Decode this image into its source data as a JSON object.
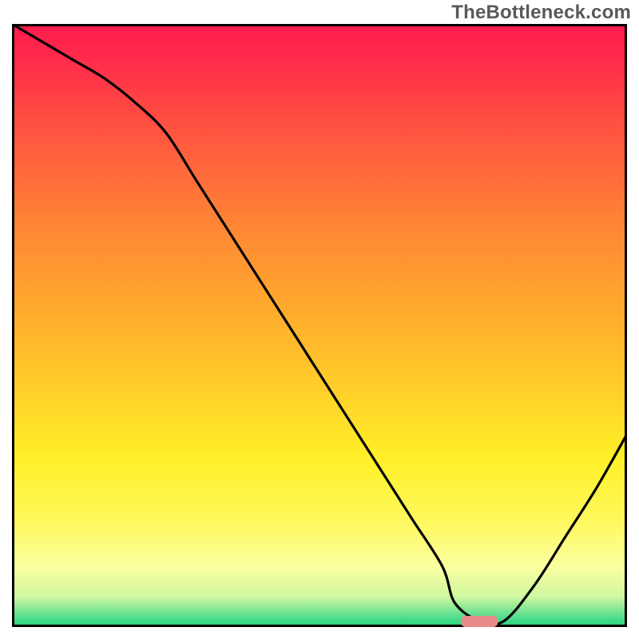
{
  "watermark": "TheBottleneck.com",
  "chart_data": {
    "type": "line",
    "title": "",
    "xlabel": "",
    "ylabel": "",
    "xlim": [
      0,
      100
    ],
    "ylim": [
      0,
      100
    ],
    "x": [
      0,
      5,
      10,
      15,
      20,
      25,
      30,
      35,
      40,
      45,
      50,
      55,
      60,
      65,
      70,
      72,
      76,
      80,
      85,
      90,
      95,
      100
    ],
    "values": [
      100,
      97,
      94,
      91,
      87,
      82,
      74,
      66,
      58,
      50,
      42,
      34,
      26,
      18,
      10,
      4,
      1,
      1,
      7,
      15,
      23,
      32
    ],
    "series": [
      {
        "name": "bottleneck-curve",
        "color": "#000000"
      }
    ],
    "background_gradient": {
      "stops": [
        {
          "offset": 0.0,
          "color": "#ff1a4d"
        },
        {
          "offset": 0.06,
          "color": "#ff2b4a"
        },
        {
          "offset": 0.18,
          "color": "#ff5540"
        },
        {
          "offset": 0.35,
          "color": "#ff8a33"
        },
        {
          "offset": 0.55,
          "color": "#ffbf2a"
        },
        {
          "offset": 0.72,
          "color": "#fff028"
        },
        {
          "offset": 0.82,
          "color": "#fff85a"
        },
        {
          "offset": 0.9,
          "color": "#faffa0"
        },
        {
          "offset": 0.95,
          "color": "#d0f7a0"
        },
        {
          "offset": 0.98,
          "color": "#60e090"
        },
        {
          "offset": 1.0,
          "color": "#1fd37a"
        }
      ]
    },
    "marker": {
      "x": 76,
      "width": 6,
      "color": "#e98a8a",
      "name": "optimal-range"
    }
  }
}
